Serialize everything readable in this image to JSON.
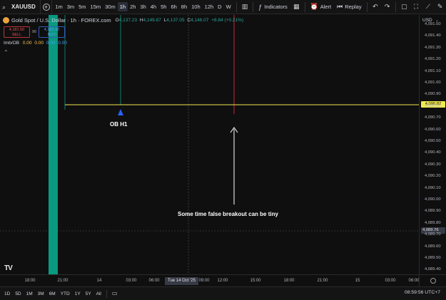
{
  "toolbar": {
    "symbol": "XAUUSD",
    "timeframes": [
      {
        "label": "1m",
        "active": false
      },
      {
        "label": "3m",
        "active": false
      },
      {
        "label": "5m",
        "active": false
      },
      {
        "label": "15m",
        "active": false
      },
      {
        "label": "30m",
        "active": false
      },
      {
        "label": "1h",
        "active": true
      },
      {
        "label": "2h",
        "active": false
      },
      {
        "label": "3h",
        "active": false
      },
      {
        "label": "4h",
        "active": false
      },
      {
        "label": "5h",
        "active": false
      },
      {
        "label": "6h",
        "active": false
      },
      {
        "label": "8h",
        "active": false
      },
      {
        "label": "10h",
        "active": false
      },
      {
        "label": "12h",
        "active": false
      },
      {
        "label": "D",
        "active": false
      },
      {
        "label": "W",
        "active": false
      }
    ],
    "indicators_label": "Indicators",
    "alert_label": "Alert",
    "replay_label": "Replay"
  },
  "legend": {
    "title": "Gold Spot / U.S. Dollar · 1h · FOREX.com",
    "o_key": "O",
    "o_val": "4,137.23",
    "h_key": "H",
    "h_val": "4,149.87",
    "l_key": "L",
    "l_val": "4,137.05",
    "c_key": "C",
    "c_val": "4,146.07",
    "change": "+8.84 (+0.21%)"
  },
  "trade": {
    "sell_price": "4,181.50",
    "sell_label": "SELL",
    "spread": "90",
    "buy_price": "4,182.40",
    "buy_label": "BUY"
  },
  "imb": {
    "label": "Imb/OB",
    "v1": "0.00",
    "v2": "0.00",
    "v3": "0.00",
    "v4": "0.00"
  },
  "annotations": {
    "ob_label": "OB H1",
    "note": "Some time false breakout can be tiny",
    "tv_logo": "TV"
  },
  "price_axis": {
    "currency": "USD",
    "ticks": [
      "4,091.50",
      "4,091.40",
      "4,091.30",
      "4,091.20",
      "4,091.10",
      "4,091.00",
      "4,090.90",
      "4,090.80",
      "4,090.70",
      "4,090.60",
      "4,090.50",
      "4,090.40",
      "4,090.30",
      "4,090.20",
      "4,090.10",
      "4,090.00",
      "4,089.90",
      "4,089.80",
      "4,089.70",
      "4,089.60",
      "4,089.50",
      "4,089.40"
    ],
    "ob_price": "4,090.82",
    "cross_price": "4,089.76"
  },
  "time_axis": {
    "ticks": [
      "18:00",
      "21:00",
      "14",
      "03:00",
      "06:00",
      "09:00",
      "12:00",
      "15:00",
      "18:00",
      "21:00",
      "15",
      "03:00",
      "06:00"
    ],
    "crosshair": "Tue 14 Oct '25"
  },
  "bottom": {
    "ranges": [
      "1D",
      "5D",
      "1M",
      "3M",
      "6M",
      "YTD",
      "1Y",
      "5Y",
      "All"
    ],
    "clock": "08:59:56 UTC+7"
  },
  "colors": {
    "background": "#0f0f0f",
    "bull_candle": "#089981",
    "ob_line": "#f2e94e",
    "ob_marker": "#2962ff",
    "bear_line": "#f23645"
  }
}
